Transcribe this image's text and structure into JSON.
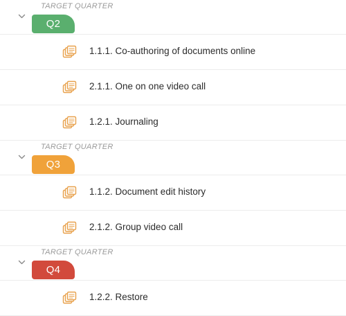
{
  "groups": [
    {
      "section_label": "TARGET QUARTER",
      "quarter": "Q2",
      "color": "#5aaf6e",
      "items": [
        {
          "label": "1.1.1. Co-authoring of documents online"
        },
        {
          "label": "2.1.1. One on one video call"
        },
        {
          "label": "1.2.1. Journaling"
        }
      ]
    },
    {
      "section_label": "TARGET QUARTER",
      "quarter": "Q3",
      "color": "#f0a23a",
      "items": [
        {
          "label": "1.1.2. Document edit history"
        },
        {
          "label": "2.1.2. Group video call"
        }
      ]
    },
    {
      "section_label": "TARGET QUARTER",
      "quarter": "Q4",
      "color": "#d24a3c",
      "items": [
        {
          "label": "1.2.2. Restore"
        }
      ]
    }
  ],
  "icons": {
    "chevron": "chevron-down-icon",
    "item": "stacked-documents-icon"
  },
  "icon_color": "#e8a04a"
}
